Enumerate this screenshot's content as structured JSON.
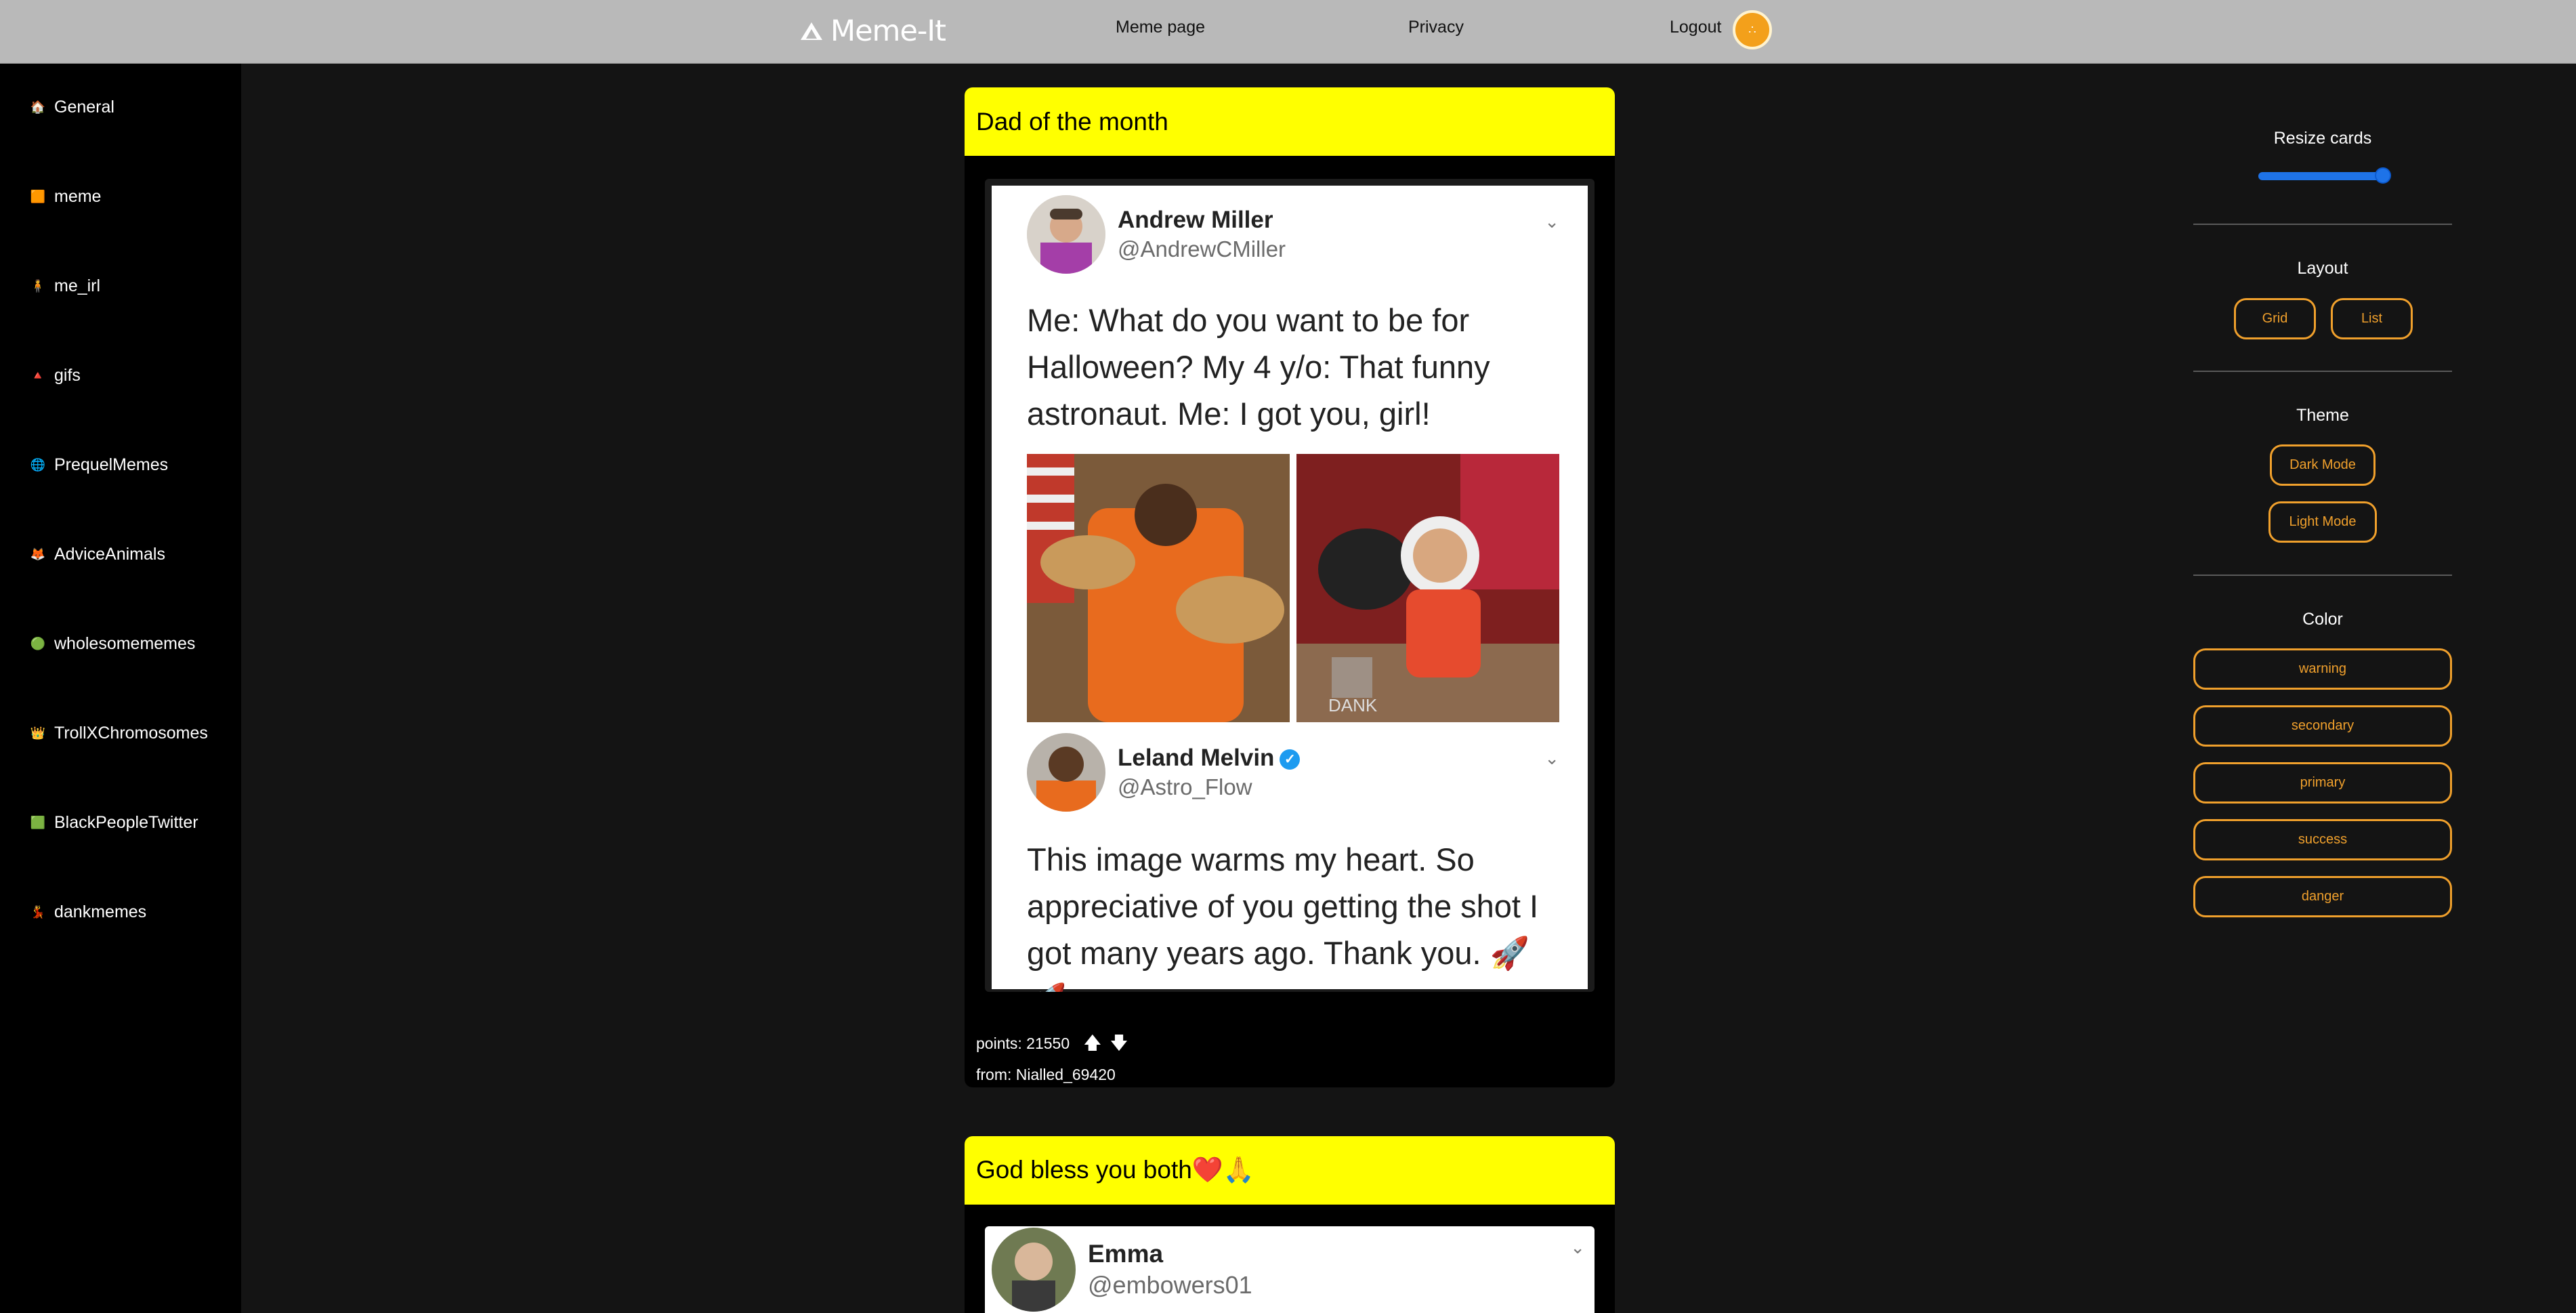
{
  "header": {
    "brand": "Meme-It",
    "links": [
      "Meme page",
      "Privacy",
      "Logout"
    ],
    "avatar_glyph": "∴"
  },
  "sidebar": {
    "items": [
      {
        "label": "General",
        "icon": "home-icon",
        "glyph": "🏠"
      },
      {
        "label": "meme",
        "icon": "meme-icon",
        "glyph": "🟧"
      },
      {
        "label": "me_irl",
        "icon": "person-icon",
        "glyph": "🧍"
      },
      {
        "label": "gifs",
        "icon": "gif-icon",
        "glyph": "🔺"
      },
      {
        "label": "PrequelMemes",
        "icon": "prequel-icon",
        "glyph": "🌐"
      },
      {
        "label": "AdviceAnimals",
        "icon": "advice-icon",
        "glyph": "🦊"
      },
      {
        "label": "wholesomememes",
        "icon": "wholesome-icon",
        "glyph": "🟢"
      },
      {
        "label": "TrollXChromosomes",
        "icon": "troll-icon",
        "glyph": "👑"
      },
      {
        "label": "BlackPeopleTwitter",
        "icon": "bpt-icon",
        "glyph": "🟩"
      },
      {
        "label": "dankmemes",
        "icon": "dank-icon",
        "glyph": "💃"
      }
    ]
  },
  "posts": [
    {
      "title": "Dad of the month",
      "tweet1": {
        "name": "Andrew Miller",
        "handle": "@AndrewCMiller",
        "text": "Me: What do you want to be for Halloween? My 4 y/o: That funny astronaut. Me: I got you, girl!"
      },
      "tweet2": {
        "name": "Leland Melvin",
        "handle": "@Astro_Flow",
        "text": "This image warms my heart.  So appreciative of you getting the shot I got many years ago. Thank you. 🚀🚀"
      },
      "watermark": "DANK",
      "points_label": "points: 21550",
      "from_label": "from: Nialled_69420"
    },
    {
      "title": "God bless you both❤️🙏",
      "tweet1": {
        "name": "Emma",
        "handle": "@embowers01"
      }
    }
  ],
  "panel": {
    "resize_title": "Resize cards",
    "resize_value": 1.0,
    "layout_title": "Layout",
    "layout_options": [
      "Grid",
      "List"
    ],
    "theme_title": "Theme",
    "theme_options": [
      "Dark Mode",
      "Light Mode"
    ],
    "color_title": "Color",
    "color_options": [
      "warning",
      "secondary",
      "primary",
      "success",
      "danger"
    ]
  },
  "colors": {
    "topbar": "#b9b9b9",
    "accent": "#f0a02c",
    "card_header": "#ffff00",
    "slider": "#1e73e8"
  }
}
